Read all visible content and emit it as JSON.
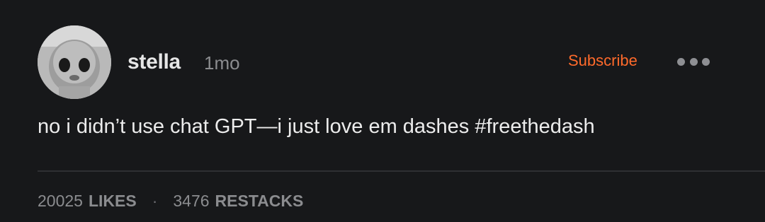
{
  "post": {
    "author": "stella",
    "time": "1mo",
    "subscribe_label": "Subscribe",
    "more_icon": "more-horizontal-icon",
    "body": "no i didn’t use chat GPT—i just love em dashes #freethedash",
    "likes_count": "20025",
    "likes_label": "LIKES",
    "separator": "·",
    "restacks_count": "3476",
    "restacks_label": "RESTACKS"
  },
  "colors": {
    "background": "#17181a",
    "accent": "#ff6a2b",
    "muted": "#8b8c8f"
  }
}
